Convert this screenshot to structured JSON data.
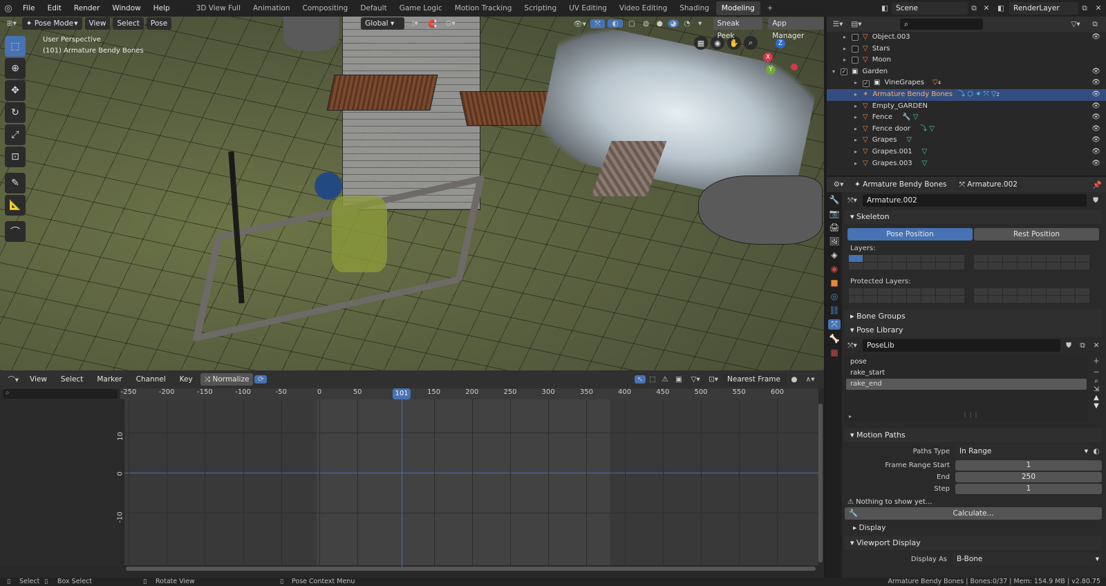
{
  "topbar": {
    "menus": [
      "File",
      "Edit",
      "Render",
      "Window",
      "Help"
    ],
    "workspaces": [
      "3D View Full",
      "Animation",
      "Compositing",
      "Default",
      "Game Logic",
      "Motion Tracking",
      "Scripting",
      "UV Editing",
      "Video Editing",
      "Shading",
      "Modeling"
    ],
    "active_workspace": "Modeling",
    "add": "+",
    "scene": "Scene",
    "renderlayer": "RenderLayer"
  },
  "viewport": {
    "mode": "Pose Mode",
    "menus": [
      "View",
      "Select",
      "Pose"
    ],
    "orientation": "Global",
    "sneak": "Sneak Peek",
    "appmgr": "App Manager",
    "overlay_line1": "User Perspective",
    "overlay_line2": "(101) Armature Bendy Bones",
    "gizmo": {
      "x": "X",
      "y": "Y",
      "z": "Z"
    }
  },
  "graph": {
    "menus": [
      "View",
      "Select",
      "Marker",
      "Channel",
      "Key"
    ],
    "normalize": "Normalize",
    "snap": "Nearest Frame",
    "ticks": [
      "-250",
      "-200",
      "-150",
      "-100",
      "-50",
      "0",
      "50",
      "101",
      "150",
      "200",
      "250",
      "300",
      "350",
      "400",
      "450",
      "500",
      "550",
      "600"
    ],
    "current_frame": "101",
    "yticks": [
      "10",
      "0",
      "-10"
    ]
  },
  "status": {
    "select": "Select",
    "box": "Box Select",
    "rotate": "Rotate View",
    "ctx": "Pose Context Menu",
    "info": "Armature Bendy Bones | Bones:0/37 | Mem: 154.9 MB | v2.80.75"
  },
  "outliner": {
    "rows": [
      {
        "name": "Object.003",
        "indent": 1
      },
      {
        "name": "Stars",
        "indent": 1
      },
      {
        "name": "Moon",
        "indent": 1
      },
      {
        "name": "Garden",
        "indent": 0
      },
      {
        "name": "VineGrapes",
        "indent": 2
      },
      {
        "name": "Armature Bendy Bones",
        "indent": 2
      },
      {
        "name": "Empty_GARDEN",
        "indent": 2
      },
      {
        "name": "Fence",
        "indent": 2
      },
      {
        "name": "Fence door",
        "indent": 2
      },
      {
        "name": "Grapes",
        "indent": 2
      },
      {
        "name": "Grapes.001",
        "indent": 2
      },
      {
        "name": "Grapes.003",
        "indent": 2
      }
    ],
    "selected": "Armature Bendy Bones",
    "badge_vine": "4",
    "badge_arm": "2"
  },
  "props": {
    "obj": "Armature Bendy Bones",
    "data": "Armature.002",
    "datablock": "Armature.002",
    "skeleton": "Skeleton",
    "pose_pos": "Pose Position",
    "rest_pos": "Rest Position",
    "layers": "Layers:",
    "prot_layers": "Protected Layers:",
    "bone_groups": "Bone Groups",
    "pose_library": "Pose Library",
    "poselib": "PoseLib",
    "poses": [
      "pose",
      "rake_start",
      "rake_end"
    ],
    "active_pose": "rake_end",
    "motion_paths": "Motion Paths",
    "paths_type_lbl": "Paths Type",
    "paths_type": "In Range",
    "frs_lbl": "Frame Range Start",
    "frs": "1",
    "end_lbl": "End",
    "end": "250",
    "step_lbl": "Step",
    "step": "1",
    "nothing": "Nothing to show yet...",
    "calc": "Calculate...",
    "display": "Display",
    "vp_display": "Viewport Display",
    "display_as_lbl": "Display As",
    "display_as": "B-Bone"
  },
  "colors": {
    "accent": "#4772b3",
    "selected_row": "#334d80",
    "playhead": "#4772b3"
  }
}
